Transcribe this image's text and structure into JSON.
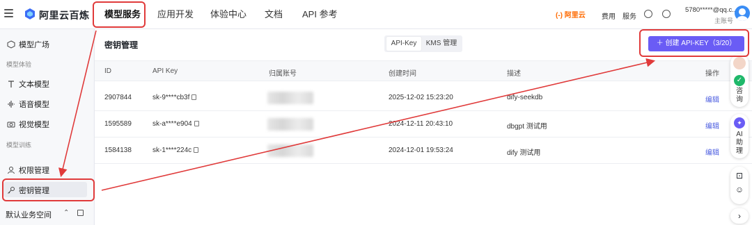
{
  "header": {
    "brand": "阿里云百炼",
    "nav": [
      "模型服务",
      "应用开发",
      "体验中心",
      "文档",
      "API 参考"
    ],
    "aliyun_logo_text": "(-) 阿里云",
    "links": [
      "费用",
      "服务"
    ],
    "account_email": "5780*****@qq.c...",
    "account_sub": "主账号"
  },
  "sidebar": {
    "items_top": [
      "模型广场"
    ],
    "group_model_exp": "模型体验",
    "items_exp": [
      "文本模型",
      "语音模型",
      "视觉模型"
    ],
    "group_model_train": "模型训练",
    "items_train": [
      "权限管理",
      "密钥管理"
    ],
    "footer": "默认业务空间"
  },
  "main": {
    "title": "密钥管理",
    "tabs": [
      "API-Key",
      "KMS 管理"
    ],
    "create_button": "创建 API-KEY（3/20）",
    "columns": [
      "ID",
      "API Key",
      "归属账号",
      "创建时间",
      "描述",
      "操作"
    ],
    "rows": [
      {
        "id": "2907844",
        "key": "sk-9****cb3f",
        "created": "2025-12-02 15:23:20",
        "desc": "dify-seekdb",
        "action": "编辑"
      },
      {
        "id": "1595589",
        "key": "sk-a****e904",
        "created": "2024-12-11 20:43:10",
        "desc": "dbgpt 测试用",
        "action": "编辑"
      },
      {
        "id": "1584138",
        "key": "sk-1****224c",
        "created": "2024-12-01 19:53:24",
        "desc": "dify 测试用",
        "action": "编辑"
      }
    ]
  },
  "right_panel": {
    "consult": "咨询",
    "ai_assistant": "AI助理"
  },
  "colors": {
    "accent": "#6a5cf5",
    "annotation_red": "#e03a3a",
    "link": "#4e5fe0"
  }
}
